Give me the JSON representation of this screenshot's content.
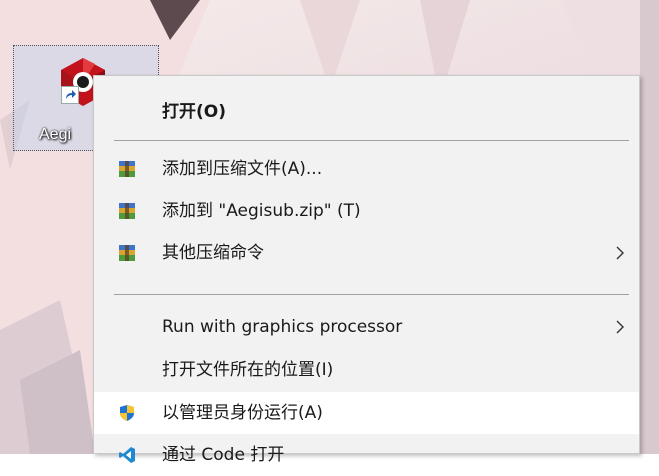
{
  "desktop": {
    "icon_label": "Aegi"
  },
  "context_menu": {
    "open_label": "打开(O)",
    "items": [
      {
        "label": "添加到压缩文件(A)...",
        "icon": "winrar-archive-icon"
      },
      {
        "label": "添加到 \"Aegisub.zip\" (T)",
        "icon": "winrar-archive-icon"
      },
      {
        "label": "其他压缩命令",
        "icon": "winrar-archive-icon",
        "submenu": true
      },
      {
        "label": "Run with graphics processor",
        "submenu": true
      },
      {
        "label": "打开文件所在的位置(I)"
      },
      {
        "label": "以管理员身份运行(A)",
        "icon": "uac-shield-icon",
        "highlighted": true
      },
      {
        "label": "通过 Code 打开",
        "icon": "vscode-icon"
      }
    ]
  },
  "colors": {
    "menu_background": "#f2f2f2",
    "menu_highlight": "#ffffff",
    "separator": "#a0a0a0",
    "shield_blue": "#1e73d8",
    "shield_yellow": "#f6c531",
    "vscode_blue": "#1f8ad2"
  }
}
